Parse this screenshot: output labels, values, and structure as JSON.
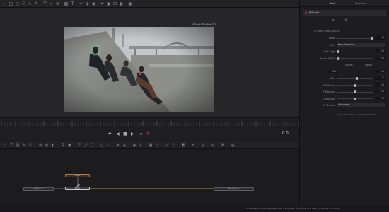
{
  "viewer": {
    "label": "1920x1080xfloat32"
  },
  "inspector": {
    "tabs": [
      "Tools",
      "Modifiers"
    ],
    "node_title": "Ellipse1",
    "subtabs": [
      "controls-icon",
      "settings-icon"
    ],
    "show_view_controls": "Show View Controls",
    "rows": [
      {
        "label": "Level",
        "value": "1.0",
        "kind": "slider",
        "frac": 1.0
      },
      {
        "label": "Filter",
        "value": "Fast Gaussian",
        "kind": "dropdown"
      },
      {
        "label": "Soft Edge",
        "value": "0.0",
        "kind": "slider",
        "frac": 0.0
      },
      {
        "label": "Border Width",
        "value": "0.0",
        "kind": "slider",
        "frac": 0.0
      },
      {
        "label": "",
        "value": "",
        "kind": "checks",
        "checks": [
          "Invert",
          "Solid"
        ]
      },
      {
        "label": "Center",
        "value": "0.5",
        "value2": "0.5",
        "kind": "pair"
      },
      {
        "label": "Size",
        "value": "1.0",
        "kind": "slider",
        "frac": 0.55
      },
      {
        "label": "X Rotation",
        "value": "0.0",
        "kind": "slider",
        "frac": 0.5
      },
      {
        "label": "Y Rotation",
        "value": "0.0",
        "kind": "slider",
        "frac": 0.5
      },
      {
        "label": "Z Rotation",
        "value": "0.0",
        "kind": "slider",
        "frac": 0.5
      },
      {
        "label": "CS Method",
        "value": "Alternate",
        "kind": "dropdown"
      }
    ],
    "hint": "Right-click here for shape animation"
  },
  "timeline": {
    "timecode": "0.0"
  },
  "node_graph": {
    "nodes": [
      "Ellipse1",
      "MediaIn1",
      "Blur1",
      "MediaOut1"
    ]
  },
  "status": {
    "text": "5 items selected  46.8 average  1.0/1 frames/sec  Time taken 4.5 secs  Timeline at 24.0/24M"
  },
  "colors": {
    "accent_red": "#d03a3a",
    "link_yellow": "#d8c23a",
    "bg": "#1b1b1d"
  }
}
